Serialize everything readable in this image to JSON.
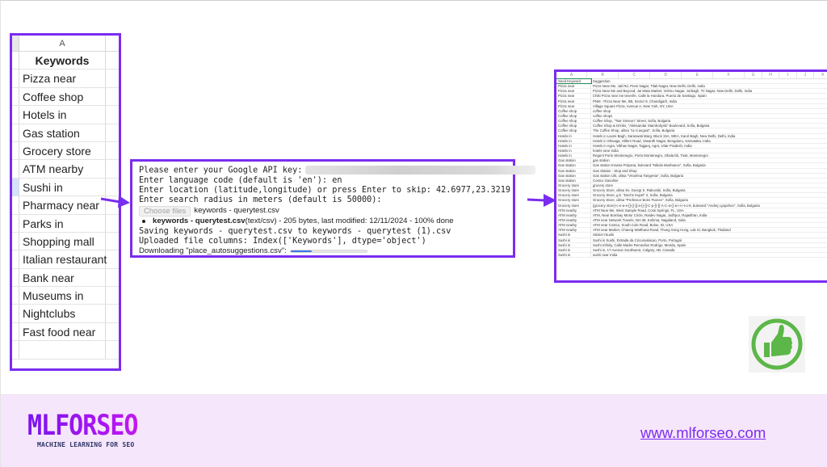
{
  "left_sheet": {
    "column_header": "A",
    "header": "Keywords",
    "selected_row_index": 6,
    "keywords": [
      "Pizza near",
      "Coffee shop",
      "Hotels in",
      "Gas station",
      "Grocery store",
      "ATM nearby",
      "Sushi in",
      "Pharmacy near",
      "Parks in",
      "Shopping mall",
      "Italian restaurant",
      "Bank near",
      "Museums in",
      "Nightclubs",
      "Fast food near",
      ""
    ]
  },
  "console": {
    "api_prompt": "Please enter your Google API key:",
    "language_line": "Enter language code (default is 'en'): en",
    "location_line": "Enter location (latitude,longitude) or press Enter to skip: 42.6977,23.3219",
    "radius_line": "Enter search radius in meters (default is 50000):",
    "choose_files_label": "Choose files",
    "chosen_file": "keywords - querytest.csv",
    "file_name_bold": "keywords - querytest.csv",
    "file_details": "(text/csv) - 205 bytes, last modified: 12/11/2024 - 100% done",
    "saving_line": "Saving keywords - querytest.csv to keywords - querytest (1).csv",
    "columns_line": "Uploaded file columns: Index(['Keywords'], dtype='object')",
    "downloading_line": "Downloading \"place_autosuggestions.csv\":",
    "download_progress_percent": 28
  },
  "right_sheet": {
    "columns": [
      "A",
      "B",
      "C",
      "D",
      "E",
      "F",
      "G",
      "H",
      "I",
      "J",
      "K"
    ],
    "header_row": [
      "Seed Keyword",
      "Suggestion"
    ],
    "rows": [
      [
        "Pizza near",
        "Pizza Near Me, Jail Rd, Prem Nagar, Tilak Nagar, New Delhi, Delhi, India"
      ],
      [
        "Pizza near",
        "Pizza Near Me and Beyond, Jai Mata Market, Vishnu Nagar, Jorbagh, Tri Nagar, New Delhi, Delhi, India"
      ],
      [
        "Pizza near",
        "Chiki Pizza near me tenerife, Calle la Hondura, Puerto de Santiago, Spain"
      ],
      [
        "Pizza near",
        "PNM - Pizza Near Me, 8B, Sector 8, Chandigarh, India"
      ],
      [
        "Pizza near",
        "Village Square Pizza, Avenue A, New York, NY, USA"
      ],
      [
        "Coffee shop",
        "coffee shop"
      ],
      [
        "Coffee shop",
        "coffee shops"
      ],
      [
        "Coffee shop",
        "Coffee Shop, \"Tsar Simeon\" Street, Sofia, Bulgaria"
      ],
      [
        "Coffee shop",
        "Coffee Shop & Drinks, \"Aleksandar Stamboliyski\" Boulevard, Sofia, Bulgaria"
      ],
      [
        "Coffee shop",
        "The Coffee Shop, ulitsa \"11-ti avgust\", Sofia, Bulgaria"
      ],
      [
        "Hotels in",
        "Hotels in Laxmi Bagh, Saraswati Marg, Block 15A, WEA, Karol Bagh, New Delhi, Delhi, India"
      ],
      [
        "Hotels in",
        "Hotels in Shivaga, Hillern Road, Vasanth Nagar, Bengaluru, Karnataka, India"
      ],
      [
        "Hotels in",
        "Hotels in Agra, Vibhav Nagar, Tajganj, Agra, Uttar Pradesh, India"
      ],
      [
        "Hotels in",
        "hotels near India"
      ],
      [
        "Hotels in",
        "Regent Porto Montenegro, Porto Montenegro, Obala bb, Tivat, Montenegro"
      ],
      [
        "Gas station",
        "gas station"
      ],
      [
        "Gas station",
        "Gas station Krasna Polyana, bulevard \"Nikola Mushanov\", Sofia, Bulgaria"
      ],
      [
        "Gas station",
        "Gas Station - Stop and Shop"
      ],
      [
        "Gas station",
        "Gas station Ulit, ulitsa \"Vrtoshna Tangenta\", Sofia, Bulgaria"
      ],
      [
        "Gas station",
        "Costco Gasoline"
      ],
      [
        "Grocery store",
        "grocery store"
      ],
      [
        "Grocery store",
        "Grocery Store, ulitsa Sv. Georgi S. Rakovski, Sofia, Bulgaria"
      ],
      [
        "Grocery store",
        "Grocery Store, g.k. \"Dechs Kupel\" 2, Sofia, Bulgaria"
      ],
      [
        "Grocery store",
        "Grocery Store, ulitsa \"Professor Boris Tsonev\", Sofia, Bulgaria"
      ],
      [
        "Grocery store",
        "(grocery store)-c-e-a-e-[]-()-[]-a-()-[]-C-p-()-[]-A-C-a-()-a-i-i-i-t-o-8, bulevard \"Andrej Lyapchev\", Sofia, Bulgaria"
      ],
      [
        "ATM nearby",
        "ATM Near Me, West Sample Road, Coral Springs, FL, USA"
      ],
      [
        "ATM nearby",
        "ATM, Near Bombay Motor Circle, Raidev Nagar, Jodhpur, Rajasthan, India"
      ],
      [
        "ATM nearby",
        "ATM near Network Travels, NH-39, Kohima, Nagaland, India"
      ],
      [
        "ATM nearby",
        "ATM near Costco, South Cole Road, Boise, ID, USA"
      ],
      [
        "ATM nearby",
        "ATM near Market, Chaeng Watthana Road, Thung Song Hong, Lak Si, Bangkok, Thailand"
      ],
      [
        "Sushi in",
        "Sticks'n'Sushi"
      ],
      [
        "Sushi in",
        "Sushi in Sushi, Estrada da Circunvalacao, Porto, Portugal"
      ],
      [
        "Sushi in",
        "Sushi Infinity, Calle Madre Remedios Rodrigo, Merida, Spain"
      ],
      [
        "Sushi in",
        "Sushi in, 17 Avenue Southwest, Calgary, AB, Canada"
      ],
      [
        "Sushi in",
        "sushi near India"
      ]
    ]
  },
  "footer": {
    "logo_text": "MLFORSEO",
    "logo_tagline": "MACHINE LEARNING FOR SEO",
    "website_link": "www.mlforseo.com"
  },
  "colors": {
    "accent_purple": "#7a2cf0",
    "thumbs_green": "#5cb748",
    "footer_bg": "#f6e6fb",
    "progress_blue": "#3b78e7"
  },
  "icons": {
    "arrow_1": "arrow-right-icon",
    "arrow_2": "arrow-right-icon",
    "success": "thumbs-up-icon"
  }
}
